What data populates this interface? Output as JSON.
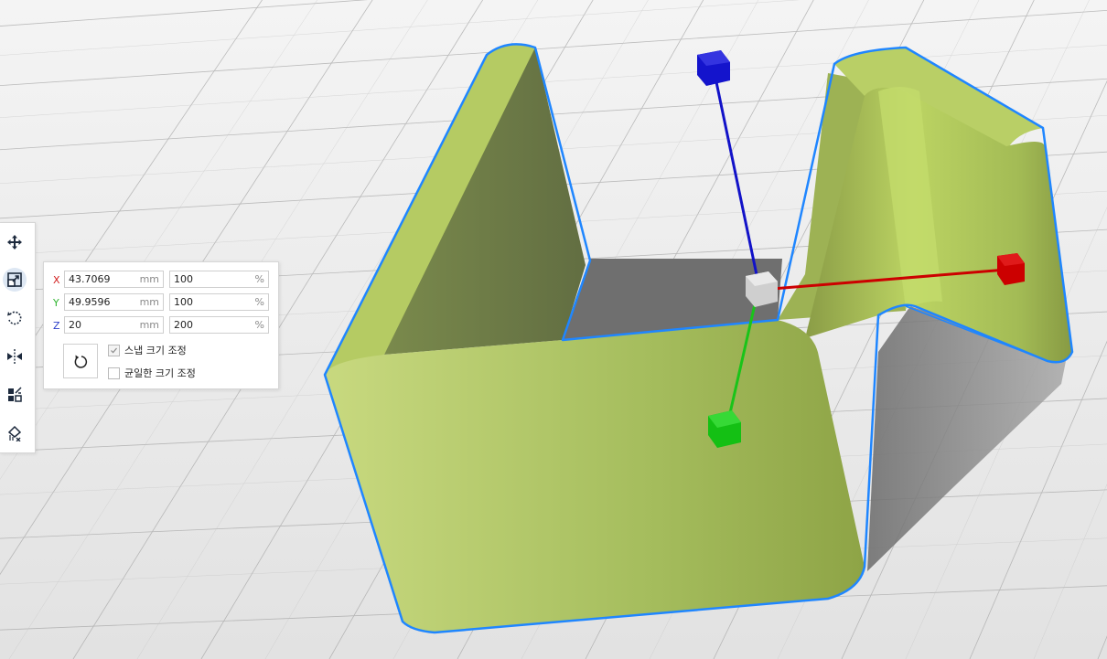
{
  "toolbar": {
    "tools": [
      {
        "name": "move-icon",
        "active": false
      },
      {
        "name": "scale-icon",
        "active": true
      },
      {
        "name": "rotate-icon",
        "active": false
      },
      {
        "name": "mirror-icon",
        "active": false
      },
      {
        "name": "arrange-icon",
        "active": false
      },
      {
        "name": "support-icon",
        "active": false
      }
    ]
  },
  "scale_panel": {
    "x": {
      "axis": "X",
      "mm": "43.7069",
      "mm_unit": "mm",
      "percent": "100",
      "percent_unit": "%"
    },
    "y": {
      "axis": "Y",
      "mm": "49.9596",
      "mm_unit": "mm",
      "percent": "100",
      "percent_unit": "%"
    },
    "z": {
      "axis": "Z",
      "mm": "20",
      "mm_unit": "mm",
      "percent": "200",
      "percent_unit": "%"
    },
    "reset_icon": "reset-icon",
    "snap_scaling": {
      "label": "스냅 크기 조정",
      "checked": true
    },
    "uniform_scaling": {
      "label": "균일한 크기 조정",
      "checked": false
    }
  },
  "colors": {
    "model": "#a9c15e",
    "model_outline": "#1f86ff",
    "axis_x": "#cc0000",
    "axis_y": "#19c419",
    "axis_z": "#1212c8",
    "handle_center": "#d0d0d0",
    "build_plate": "#e6e6e6",
    "grid": "#9a9a9a"
  }
}
